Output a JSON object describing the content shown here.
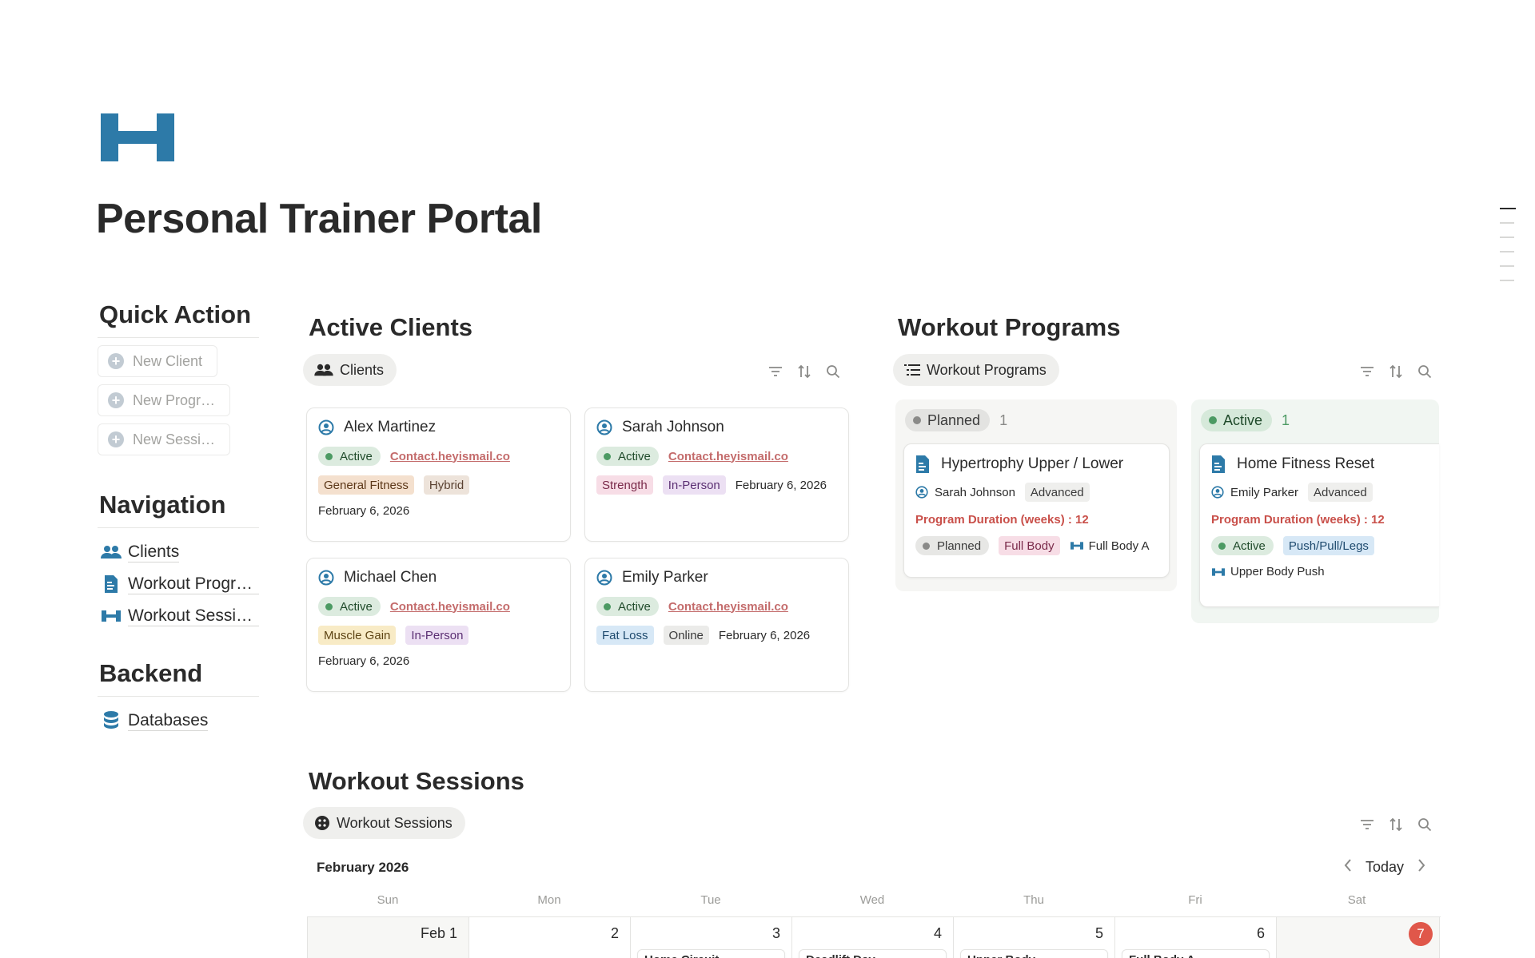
{
  "page": {
    "title": "Personal Trainer Portal",
    "icon": "dumbbell-icon"
  },
  "quick_action": {
    "heading": "Quick Action",
    "buttons": [
      {
        "label": "New Client"
      },
      {
        "label": "New Progr…"
      },
      {
        "label": "New Sessi…"
      }
    ]
  },
  "navigation": {
    "heading": "Navigation",
    "items": [
      {
        "label": "Clients",
        "icon": "people-icon"
      },
      {
        "label": "Workout Progra…",
        "icon": "document-icon"
      },
      {
        "label": "Workout Sessio…",
        "icon": "dumbbell-icon"
      }
    ]
  },
  "backend": {
    "heading": "Backend",
    "items": [
      {
        "label": "Databases",
        "icon": "database-icon"
      }
    ]
  },
  "active_clients": {
    "heading": "Active Clients",
    "view_label": "Clients",
    "cards": [
      {
        "name": "Alex Martinez",
        "status": "Active",
        "email": "Contact.heyismail.co",
        "goal": "General Fitness",
        "mode": "Hybrid",
        "date": "February 6, 2026"
      },
      {
        "name": "Sarah Johnson",
        "status": "Active",
        "email": "Contact.heyismail.co",
        "goal": "Strength",
        "mode": "In-Person",
        "date": "February 6, 2026"
      },
      {
        "name": "Michael Chen",
        "status": "Active",
        "email": "Contact.heyismail.co",
        "goal": "Muscle Gain",
        "mode": "In-Person",
        "date": "February 6, 2026"
      },
      {
        "name": "Emily Parker",
        "status": "Active",
        "email": "Contact.heyismail.co",
        "goal": "Fat Loss",
        "mode": "Online",
        "date": "February 6, 2026"
      }
    ]
  },
  "workout_programs": {
    "heading": "Workout Programs",
    "view_label": "Workout Programs",
    "columns": [
      {
        "status": "Planned",
        "count": "1",
        "card": {
          "name": "Hypertrophy Upper / Lower",
          "client": "Sarah Johnson",
          "level": "Advanced",
          "duration_label": "Program Duration (weeks) : 12",
          "status": "Planned",
          "split": "Full Body",
          "session": "Full Body A"
        }
      },
      {
        "status": "Active",
        "count": "1",
        "card": {
          "name": "Home Fitness Reset",
          "client": "Emily Parker",
          "level": "Advanced",
          "duration_label": "Program Duration (weeks) : 12",
          "status": "Active",
          "split": "Push/Pull/Legs",
          "session": "Upper Body Push"
        }
      }
    ]
  },
  "workout_sessions": {
    "heading": "Workout Sessions",
    "view_label": "Workout Sessions",
    "month": "February 2026",
    "today_label": "Today",
    "weekdays": [
      "Sun",
      "Mon",
      "Tue",
      "Wed",
      "Thu",
      "Fri",
      "Sat"
    ],
    "days": [
      {
        "num": "Feb 1",
        "event": ""
      },
      {
        "num": "2",
        "event": ""
      },
      {
        "num": "3",
        "event": "Home Circuit"
      },
      {
        "num": "4",
        "event": "Deadlift Day"
      },
      {
        "num": "5",
        "event": "Upper Body"
      },
      {
        "num": "6",
        "event": "Full Body A"
      },
      {
        "num": "7",
        "event": ""
      }
    ]
  }
}
